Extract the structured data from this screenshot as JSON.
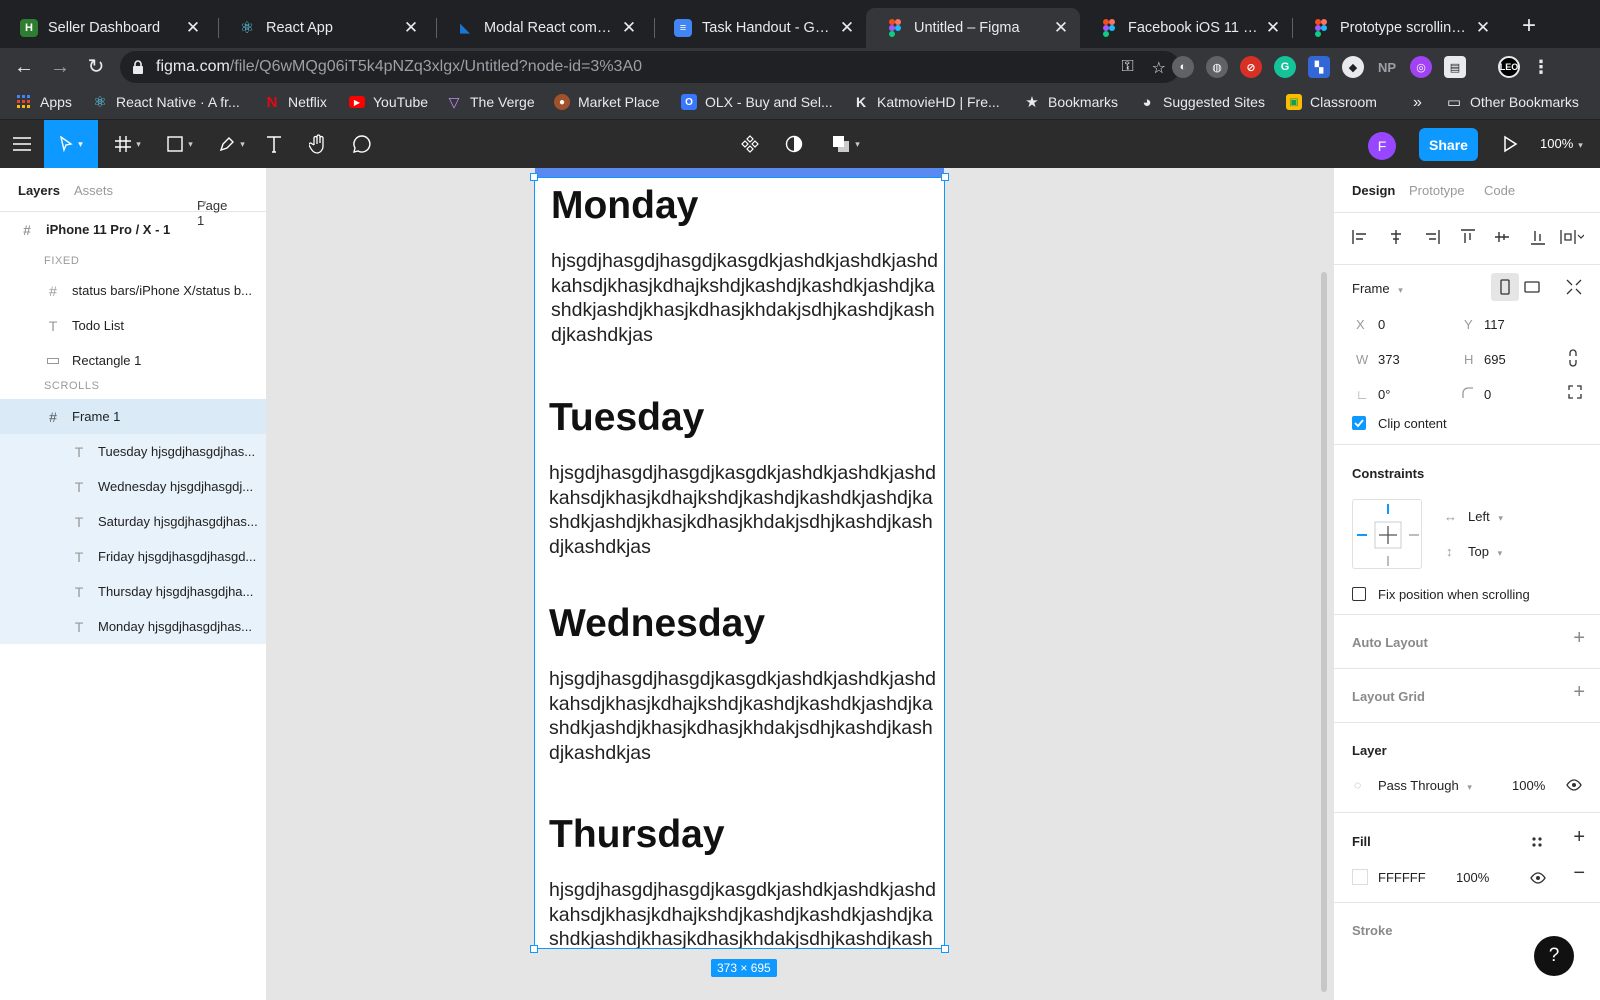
{
  "browser": {
    "tabs": [
      {
        "title": "Seller Dashboard",
        "icon": "seller-dashboard-icon",
        "color": "#2e7d32"
      },
      {
        "title": "React App",
        "icon": "react-icon",
        "color": "#61dafb"
      },
      {
        "title": "Modal React component",
        "icon": "mui-icon",
        "color": "#1976d2"
      },
      {
        "title": "Task Handout - Google Docs",
        "icon": "google-docs-icon",
        "color": "#4285f4"
      },
      {
        "title": "Untitled – Figma",
        "icon": "figma-icon",
        "color": "#f24e1e"
      },
      {
        "title": "Facebook iOS 11 (Copy)",
        "icon": "figma-icon",
        "color": "#f24e1e"
      },
      {
        "title": "Prototype scrolling with",
        "icon": "figma-icon",
        "color": "#f24e1e"
      }
    ],
    "url_host": "figma.com",
    "url_path": "/file/Q6wMQg06iT5k4pNZq3xlgx/Untitled?node-id=3%3A0",
    "bookmarks": [
      {
        "label": "Apps",
        "icon": "apps-grid-icon"
      },
      {
        "label": "React Native · A fr...",
        "icon": "react-icon"
      },
      {
        "label": "Netflix",
        "icon": "netflix-icon"
      },
      {
        "label": "YouTube",
        "icon": "youtube-icon"
      },
      {
        "label": "The Verge",
        "icon": "verge-icon"
      },
      {
        "label": "Market Place",
        "icon": "marketplace-icon"
      },
      {
        "label": "OLX - Buy and Sel...",
        "icon": "olx-icon"
      },
      {
        "label": "KatmovieHD | Fre...",
        "icon": "katmovie-icon"
      },
      {
        "label": "Bookmarks",
        "icon": "star-icon"
      },
      {
        "label": "Suggested Sites",
        "icon": "globe-icon"
      },
      {
        "label": "Classroom",
        "icon": "classroom-icon"
      }
    ],
    "bookmarks_more": "»",
    "other_bookmarks": "Other Bookmarks"
  },
  "figma_toolbar": {
    "avatar_letter": "F",
    "share_label": "Share",
    "zoom": "100%"
  },
  "left_panel": {
    "tabs": [
      "Layers",
      "Assets"
    ],
    "page_selector": "Page 1",
    "root_frame": "iPhone 11 Pro / X - 1",
    "fixed_header": "FIXED",
    "fixed_layers": [
      {
        "name": "status bars/iPhone X/status b...",
        "type": "frame"
      },
      {
        "name": "Todo List",
        "type": "text"
      },
      {
        "name": "Rectangle 1",
        "type": "rectangle"
      }
    ],
    "scrolls_header": "SCROLLS",
    "selected_layer": "Frame 1",
    "child_layers": [
      "Tuesday hjsgdjhasgdjhas...",
      "Wednesday hjsgdjhasgdj...",
      "Saturday hjsgdjhasgdjhas...",
      "Friday hjsgdjhasgdjhasgd...",
      "Thursday hjsgdjhasgdjha...",
      "Monday hjsgdjhasgdjhas..."
    ]
  },
  "canvas": {
    "days": [
      {
        "title": "Monday",
        "body": "hjsgdjhasgdjhasgdjkasgdkjashdkjashdkjashdkahsdjkhasjkdhajkshdjkashdjkashdkjashdjkashdkjashdjkhasjkdhasjkhdakjsdhjkashdjkashdjkashdkjas"
      },
      {
        "title": "Tuesday",
        "body": "hjsgdjhasgdjhasgdjkasgdkjashdkjashdkjashdkahsdjkhasjkdhajkshdjkashdjkashdkjashdjkashdkjashdjkhasjkdhasjkhdakjsdhjkashdjkashdjkashdkjas"
      },
      {
        "title": "Wednesday",
        "body": "hjsgdjhasgdjhasgdjkasgdkjashdkjashdkjashdkahsdjkhasjkdhajkshdjkashdjkashdkjashdjkashdkjashdjkhasjkdhasjkhdakjsdhjkashdjkashdjkashdkjas"
      },
      {
        "title": "Thursday",
        "body": "hjsgdjhasgdjhasgdjkasgdkjashdkjashdkjashdkahsdjkhasjkdhajkshdjkashdjkashdkjashdjkashdkjashdjkhasjkdhasjkhdakjsdhjkashdjkashdjkashdkjas"
      }
    ],
    "dimension_label": "373 × 695"
  },
  "right_panel": {
    "tabs": [
      "Design",
      "Prototype",
      "Code"
    ],
    "frame_label": "Frame",
    "x_label": "X",
    "x_value": "0",
    "y_label": "Y",
    "y_value": "117",
    "w_label": "W",
    "w_value": "373",
    "h_label": "H",
    "h_value": "695",
    "rotation_value": "0°",
    "radius_value": "0",
    "clip_content_label": "Clip content",
    "clip_content_checked": true,
    "constraints_title": "Constraints",
    "constraint_h": "Left",
    "constraint_v": "Top",
    "fix_position_label": "Fix position when scrolling",
    "auto_layout_title": "Auto Layout",
    "layout_grid_title": "Layout Grid",
    "layer_title": "Layer",
    "blend_mode": "Pass Through",
    "layer_opacity": "100%",
    "fill_title": "Fill",
    "fill_hex": "FFFFFF",
    "fill_opacity": "100%",
    "stroke_title": "Stroke",
    "help_label": "?"
  },
  "colors": {
    "figma_blue": "#0d99ff",
    "frame_topbar": "#5a8af0",
    "chrome_dark": "#202124",
    "chrome_mid": "#35363a"
  }
}
